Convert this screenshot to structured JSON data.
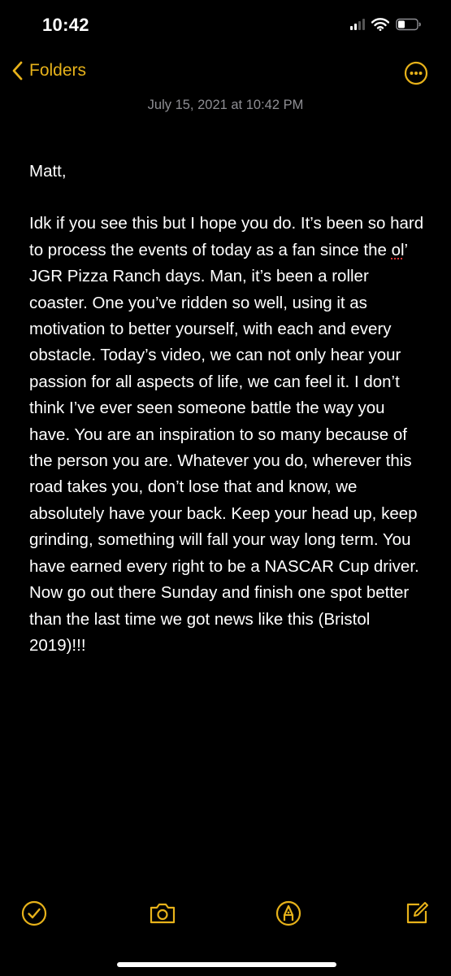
{
  "status_bar": {
    "time": "10:42"
  },
  "nav": {
    "back_label": "Folders",
    "back_icon": "chevron-left-icon",
    "more_icon": "ellipsis-circle-icon"
  },
  "note": {
    "date": "July 15, 2021 at 10:42 PM",
    "greeting": "Matt,",
    "body_before_flag": "Idk if you see this but I hope you do. It’s been so hard to process the events of today as a fan since the ",
    "body_flagged_word": "ol",
    "body_after_flag": "’ JGR Pizza Ranch days. Man, it’s been a roller coaster. One you’ve ridden so well, using it as motivation to better yourself, with each and every obstacle. Today’s video, we can not only hear your passion for all aspects of life, we can feel it. I don’t think I’ve ever seen someone battle the way you have. You are an inspiration to so many because of the person you are. Whatever you do, wherever this road takes you, don’t lose that and know, we absolutely have your back. Keep your head up, keep grinding, something will fall your way long term. You have earned every right to be a NASCAR Cup driver. Now go out there Sunday and finish one spot better than the last time we got news like this (Bristol 2019)!!!"
  },
  "toolbar": {
    "icons": [
      "checklist-icon",
      "camera-icon",
      "markup-pen-icon",
      "compose-icon"
    ]
  },
  "colors": {
    "accent": "#e7b21a",
    "background": "#000000",
    "date_text": "#8e8e93",
    "spell_error": "#dd3333"
  }
}
